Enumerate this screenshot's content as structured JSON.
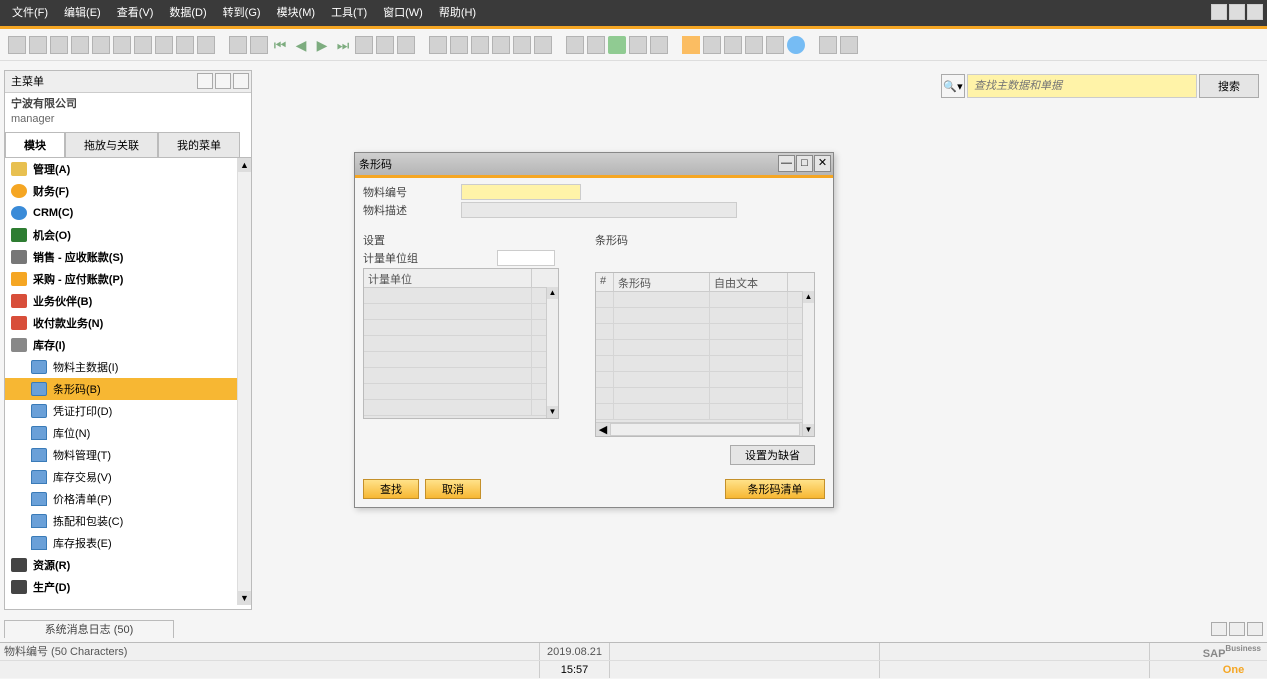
{
  "menubar": {
    "items": [
      {
        "label": "文件(F)"
      },
      {
        "label": "编辑(E)"
      },
      {
        "label": "查看(V)"
      },
      {
        "label": "数据(D)"
      },
      {
        "label": "转到(G)"
      },
      {
        "label": "模块(M)"
      },
      {
        "label": "工具(T)"
      },
      {
        "label": "窗口(W)"
      },
      {
        "label": "帮助(H)"
      }
    ]
  },
  "search_placeholder": "查找主数据和单据",
  "search_button": "搜索",
  "left_panel": {
    "title": "主菜单",
    "company": "宁波有限公司",
    "user": "manager",
    "tabs": [
      "模块",
      "拖放与关联",
      "我的菜单"
    ],
    "active_tab": 0,
    "tree": [
      {
        "label": "管理(A)",
        "level": 1,
        "icon": "ic-admin"
      },
      {
        "label": "财务(F)",
        "level": 1,
        "icon": "ic-fin"
      },
      {
        "label": "CRM(C)",
        "level": 1,
        "icon": "ic-crm"
      },
      {
        "label": "机会(O)",
        "level": 1,
        "icon": "ic-opp"
      },
      {
        "label": "销售 - 应收账款(S)",
        "level": 1,
        "icon": "ic-sales"
      },
      {
        "label": "采购 - 应付账款(P)",
        "level": 1,
        "icon": "ic-purch"
      },
      {
        "label": "业务伙伴(B)",
        "level": 1,
        "icon": "ic-bp"
      },
      {
        "label": "收付款业务(N)",
        "level": 1,
        "icon": "ic-bank"
      },
      {
        "label": "库存(I)",
        "level": 1,
        "icon": "ic-inv"
      },
      {
        "label": "物料主数据(I)",
        "level": 2,
        "icon": "ic-doc2"
      },
      {
        "label": "条形码(B)",
        "level": 2,
        "icon": "ic-doc2",
        "selected": true
      },
      {
        "label": "凭证打印(D)",
        "level": 2,
        "icon": "ic-doc2"
      },
      {
        "label": "库位(N)",
        "level": 2,
        "icon": "ic-folder"
      },
      {
        "label": "物料管理(T)",
        "level": 2,
        "icon": "ic-folder"
      },
      {
        "label": "库存交易(V)",
        "level": 2,
        "icon": "ic-folder"
      },
      {
        "label": "价格清单(P)",
        "level": 2,
        "icon": "ic-folder"
      },
      {
        "label": "拣配和包装(C)",
        "level": 2,
        "icon": "ic-folder"
      },
      {
        "label": "库存报表(E)",
        "level": 2,
        "icon": "ic-folder"
      },
      {
        "label": "资源(R)",
        "level": 1,
        "icon": "ic-res"
      },
      {
        "label": "生产(D)",
        "level": 1,
        "icon": "ic-prod"
      }
    ]
  },
  "dialog": {
    "title": "条形码",
    "item_code_label": "物料编号",
    "item_desc_label": "物料描述",
    "setup_section": "设置",
    "uom_group_label": "计量单位组",
    "uom_col": "计量单位",
    "barcode_section": "条形码",
    "col_hash": "#",
    "col_barcode": "条形码",
    "col_freetext": "自由文本",
    "set_default_btn": "设置为缺省",
    "find_btn": "查找",
    "cancel_btn": "取消",
    "barcode_list_btn": "条形码清单"
  },
  "syslog": "系统消息日志 (50)",
  "status": {
    "field_info": "物料编号 (50 Characters)",
    "date": "2019.08.21",
    "time": "15:57"
  },
  "logo": {
    "sap": "SAP",
    "business": "Business",
    "one": "One"
  }
}
